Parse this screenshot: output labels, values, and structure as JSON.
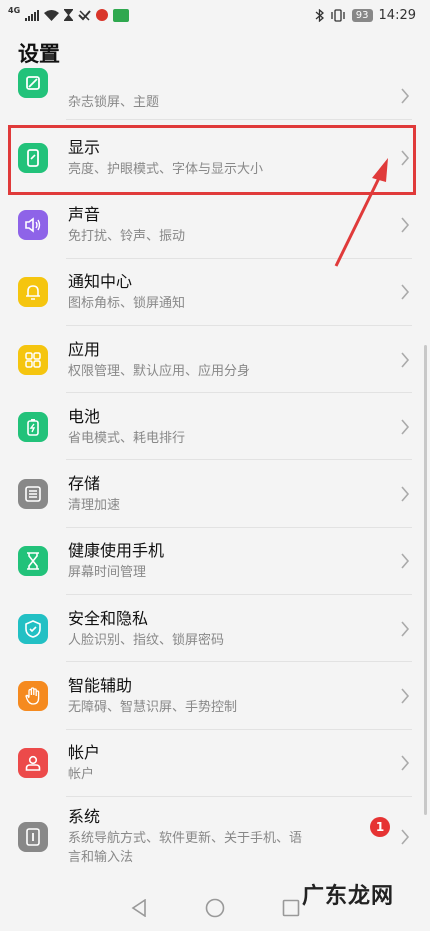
{
  "status_bar": {
    "network": "4G",
    "battery": "93",
    "time": "14:29"
  },
  "header": {
    "title": "设置"
  },
  "items": [
    {
      "title": "",
      "subtitle": "杂志锁屏、主题",
      "icon": "theme-icon",
      "color": "#22c27a"
    },
    {
      "title": "显示",
      "subtitle": "亮度、护眼模式、字体与显示大小",
      "icon": "display-icon",
      "color": "#22c27a"
    },
    {
      "title": "声音",
      "subtitle": "免打扰、铃声、振动",
      "icon": "sound-icon",
      "color": "#8e63e8"
    },
    {
      "title": "通知中心",
      "subtitle": "图标角标、锁屏通知",
      "icon": "notification-icon",
      "color": "#f5c50f"
    },
    {
      "title": "应用",
      "subtitle": "权限管理、默认应用、应用分身",
      "icon": "apps-icon",
      "color": "#f5c50f"
    },
    {
      "title": "电池",
      "subtitle": "省电模式、耗电排行",
      "icon": "battery-icon",
      "color": "#22c27a"
    },
    {
      "title": "存储",
      "subtitle": "清理加速",
      "icon": "storage-icon",
      "color": "#888888"
    },
    {
      "title": "健康使用手机",
      "subtitle": "屏幕时间管理",
      "icon": "hourglass-icon",
      "color": "#22c27a"
    },
    {
      "title": "安全和隐私",
      "subtitle": "人脸识别、指纹、锁屏密码",
      "icon": "shield-icon",
      "color": "#22c0c4"
    },
    {
      "title": "智能辅助",
      "subtitle": "无障碍、智慧识屏、手势控制",
      "icon": "hand-icon",
      "color": "#f58a1f"
    },
    {
      "title": "帐户",
      "subtitle": "帐户",
      "icon": "account-icon",
      "color": "#ec4a4a"
    },
    {
      "title": "系统",
      "subtitle": "系统导航方式、软件更新、关于手机、语",
      "subtitle2": "言和输入法",
      "icon": "system-icon",
      "color": "#888888",
      "badge": "1"
    }
  ],
  "watermark": "广东龙网"
}
